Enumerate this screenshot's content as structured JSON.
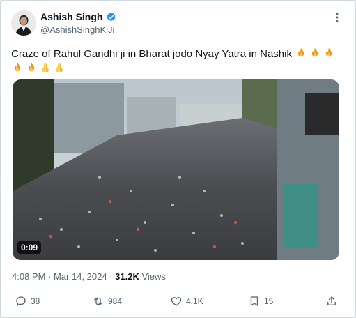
{
  "author": {
    "display_name": "Ashish Singh",
    "handle": "@AshishSinghKiJi",
    "verified": true
  },
  "tweet": {
    "text": "Craze of Rahul Gandhi ji in Bharat jodo Nyay Yatra in Nashik",
    "emojis": [
      "fire",
      "fire",
      "fire",
      "fire",
      "fire",
      "folded-hands",
      "folded-hands"
    ]
  },
  "media": {
    "type": "video",
    "duration": "0:09"
  },
  "meta": {
    "time": "4:08 PM",
    "separator": " · ",
    "date": "Mar 14, 2024",
    "views_count": "31.2K",
    "views_label": "Views"
  },
  "actions": {
    "replies": "38",
    "reposts": "984",
    "likes": "4.1K",
    "bookmarks": "15"
  },
  "colors": {
    "text": "#0f1419",
    "muted": "#536471",
    "verified_blue": "#1d9bf0",
    "border": "#cfd9de"
  }
}
